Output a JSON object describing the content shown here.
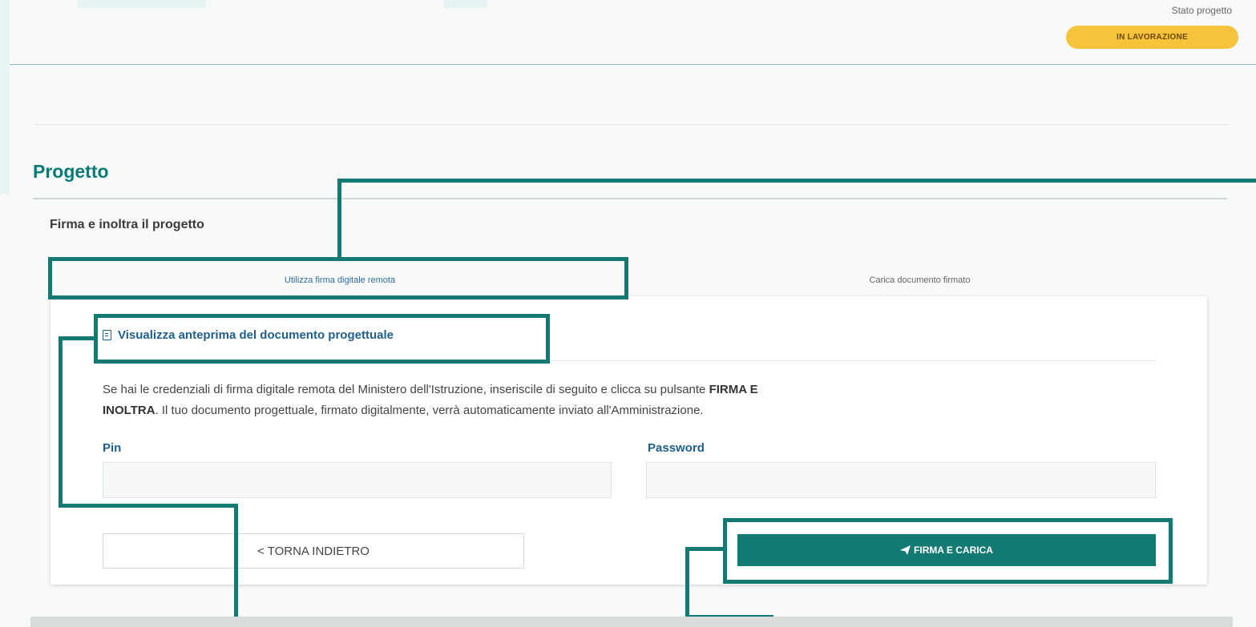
{
  "header": {
    "status_label": "Stato progetto",
    "status_badge": "IN LAVORAZIONE",
    "status_color": "#f6c33b"
  },
  "page": {
    "title": "Progetto",
    "subtitle": "Firma e inoltra il progetto"
  },
  "tabs": [
    {
      "label": "Utilizza firma digitale remota",
      "active": true
    },
    {
      "label": "Carica documento firmato",
      "active": false
    }
  ],
  "card": {
    "preview_link": "Visualizza anteprima del documento progettuale",
    "preview_icon": "document-icon",
    "desc_part1": "Se hai le credenziali di firma digitale remota del Ministero dell'Istruzione, inseriscile di seguito e clicca su pulsante ",
    "desc_bold1": "FIRMA E",
    "desc_bold2": "INOLTRA",
    "desc_part2": ". Il tuo documento progettuale, firmato digitalmente, verrà automaticamente inviato all'Amministrazione.",
    "pin_label": "Pin",
    "pin_value": "",
    "password_label": "Password",
    "password_value": "",
    "back_button": "< TORNA INDIETRO",
    "sign_button": "FIRMA E CARICA",
    "sign_icon": "paper-plane-icon"
  },
  "colors": {
    "accent": "#127a73",
    "link": "#1f5f8b",
    "title": "#0a7a74"
  }
}
